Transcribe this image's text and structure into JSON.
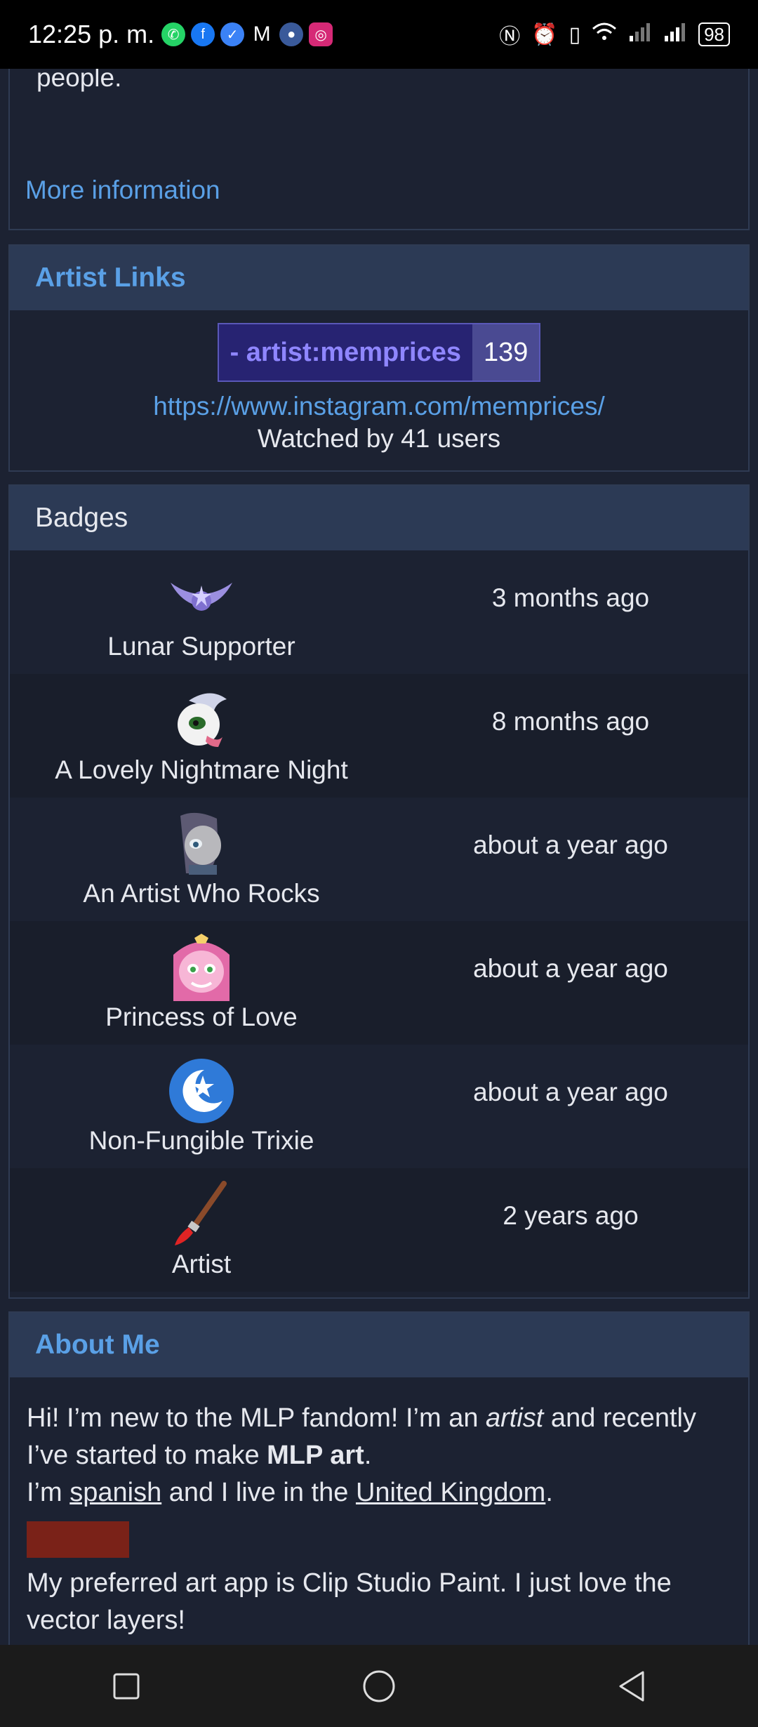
{
  "status": {
    "time": "12:25 p. m.",
    "battery": "98",
    "app_icons": [
      "whatsapp-icon",
      "facebook-icon",
      "messenger-icon",
      "gmail-icon",
      "app-icon",
      "instagram-icon"
    ],
    "system_icons": [
      "nfc-icon",
      "alarm-icon",
      "vibrate-icon",
      "wifi-icon",
      "signal-icon",
      "signal-icon"
    ]
  },
  "intro": {
    "text_tail": "people.",
    "more_info": "More information"
  },
  "artist_links": {
    "title": "Artist Links",
    "tag_name": "- artist:memprices",
    "tag_count": "139",
    "url": "https://www.instagram.com/memprices/",
    "watched": "Watched by 41 users"
  },
  "badges": {
    "title": "Badges",
    "items": [
      {
        "name": "Lunar Supporter",
        "time": "3 months ago",
        "icon": "lunar-emblem-icon"
      },
      {
        "name": "A Lovely Nightmare Night",
        "time": "8 months ago",
        "icon": "nightmare-pony-icon"
      },
      {
        "name": "An Artist Who Rocks",
        "time": "about a year ago",
        "icon": "maud-pony-icon"
      },
      {
        "name": "Princess of Love",
        "time": "about a year ago",
        "icon": "cadance-pony-icon"
      },
      {
        "name": "Non-Fungible Trixie",
        "time": "about a year ago",
        "icon": "trixie-moon-icon"
      },
      {
        "name": "Artist",
        "time": "2 years ago",
        "icon": "paintbrush-icon"
      }
    ]
  },
  "about": {
    "title": "About Me",
    "p1_a": "Hi! I’m new to the MLP fandom! I’m an ",
    "p1_em": "artist",
    "p1_b": " and recently I’ve started to make ",
    "p1_strong": "MLP art",
    "p1_c": ".",
    "p2_a": "I’m ",
    "p2_u1": "spanish",
    "p2_b": " and I live in the ",
    "p2_u2": "United Kingdom",
    "p2_c": ".",
    "p3": "My preferred art app is Clip Studio Paint. I just love the vector layers!"
  },
  "colors": {
    "accent": "#5aa0e6",
    "header_bg": "#2c3a55",
    "page_bg": "#1c2232",
    "tag_bg": "#272372",
    "tag_count_bg": "#4a4a92"
  }
}
